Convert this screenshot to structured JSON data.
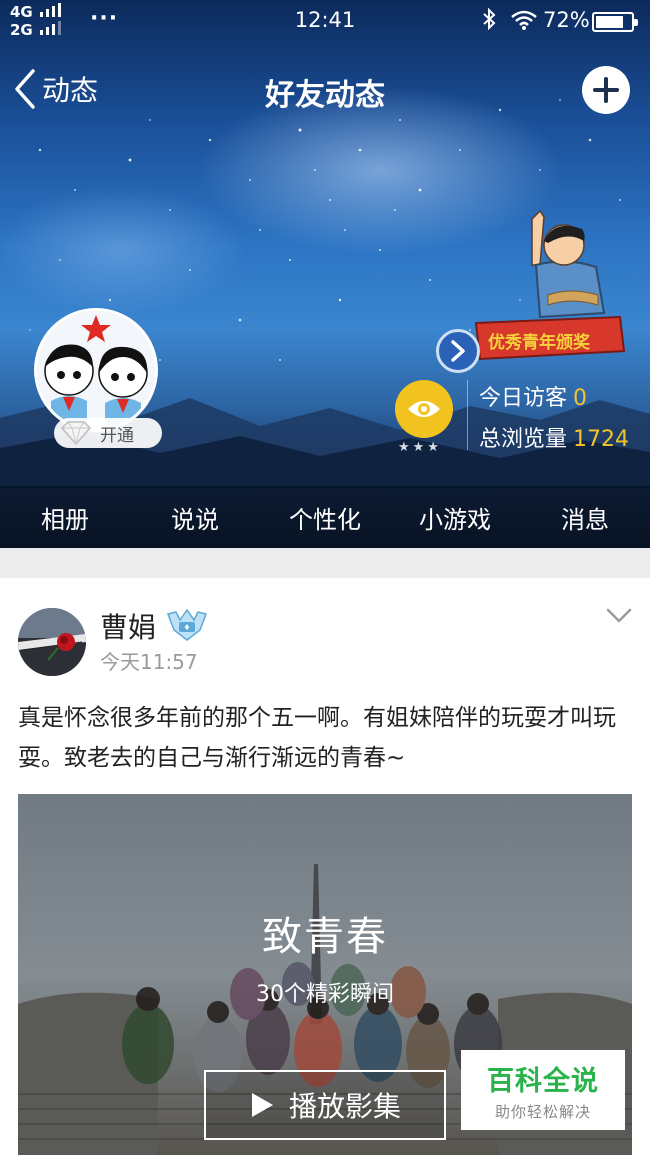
{
  "status_bar": {
    "network_1": "4G",
    "network_2": "2G",
    "dots": "···",
    "time": "12:41",
    "battery_pct": "72%"
  },
  "nav": {
    "back_label": "动态",
    "title": "好友动态"
  },
  "profile": {
    "vip_label": "开通",
    "mascot_banner": "优秀青年颁奖",
    "visits_label": "今日访客",
    "visits_value": "0",
    "views_label": "总浏览量",
    "views_value": "1724"
  },
  "tabs": [
    {
      "label": "相册"
    },
    {
      "label": "说说"
    },
    {
      "label": "个性化"
    },
    {
      "label": "小游戏"
    },
    {
      "label": "消息"
    }
  ],
  "post": {
    "author": "曹娟",
    "time": "今天11:57",
    "text": "真是怀念很多年前的那个五一啊。有姐妹陪伴的玩耍才叫玩耍。致老去的自己与渐行渐远的青春~",
    "album": {
      "title": "致青春",
      "subtitle": "30个精彩瞬间",
      "play_label": "播放影集"
    }
  },
  "watermark": {
    "main": "百科全说",
    "sub": "助你轻松解决"
  },
  "colors": {
    "accent_yellow": "#f3c42a",
    "eye_button": "#f2c21e",
    "watermark_green": "#2ab34a"
  }
}
